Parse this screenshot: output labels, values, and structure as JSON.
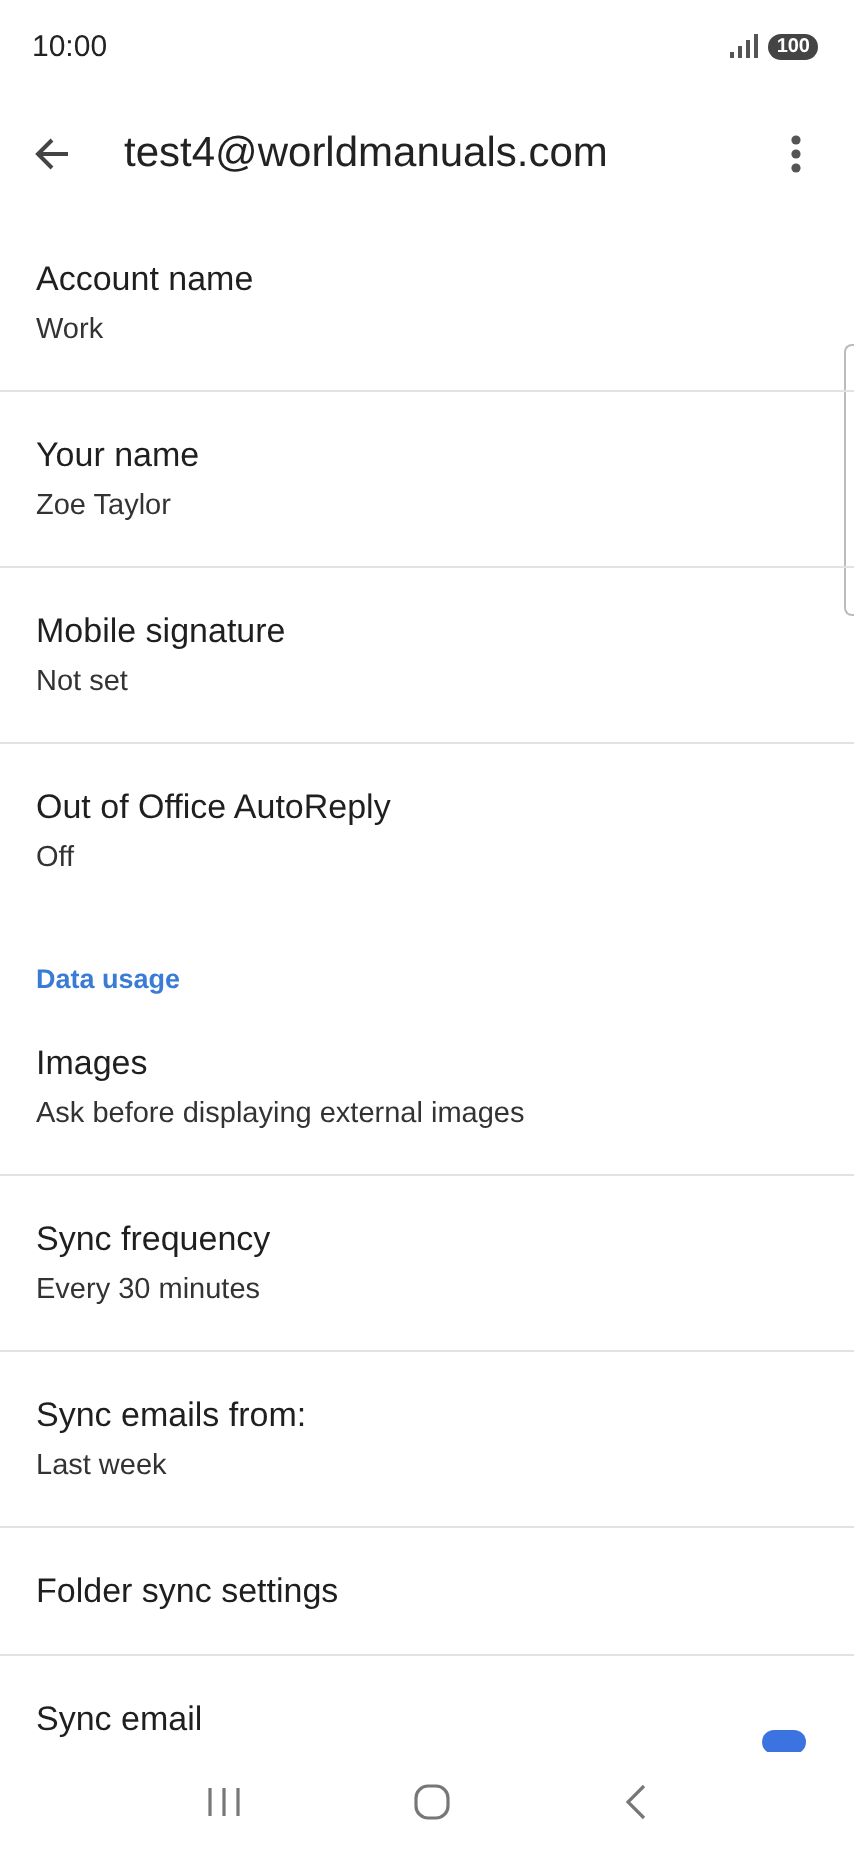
{
  "status_bar": {
    "time": "10:00",
    "battery": "100"
  },
  "toolbar": {
    "title": "test4@worldmanuals.com"
  },
  "items": [
    {
      "kind": "setting",
      "title": "Account name",
      "subtitle": "Work"
    },
    {
      "kind": "setting",
      "title": "Your name",
      "subtitle": "Zoe Taylor"
    },
    {
      "kind": "setting",
      "title": "Mobile signature",
      "subtitle": "Not set"
    },
    {
      "kind": "setting",
      "title": "Out of Office AutoReply",
      "subtitle": "Off"
    },
    {
      "kind": "header",
      "title": "Data usage"
    },
    {
      "kind": "setting",
      "title": "Images",
      "subtitle": "Ask before displaying external images"
    },
    {
      "kind": "setting",
      "title": "Sync frequency",
      "subtitle": "Every 30 minutes"
    },
    {
      "kind": "setting",
      "title": "Sync emails from:",
      "subtitle": "Last week"
    },
    {
      "kind": "setting",
      "title": "Folder sync settings"
    },
    {
      "kind": "toggle",
      "title": "Sync email",
      "on": true
    }
  ]
}
